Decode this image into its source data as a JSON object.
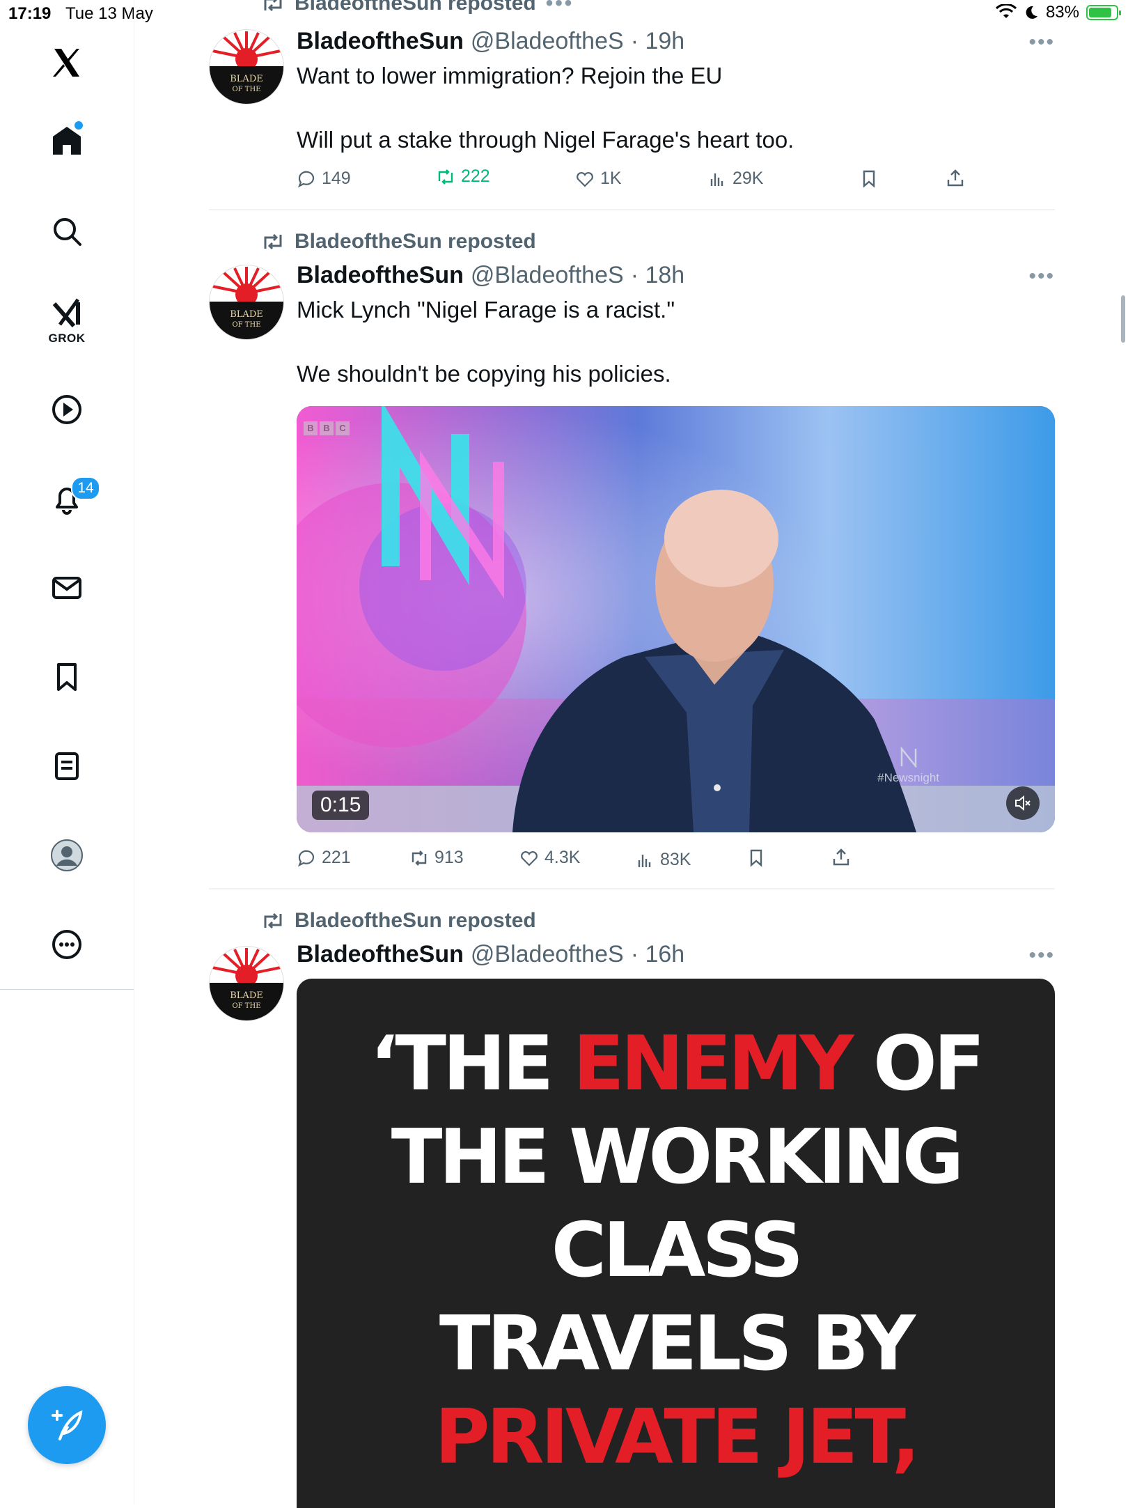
{
  "status_bar": {
    "time": "17:19",
    "date": "Tue 13 May",
    "battery": "83%",
    "battery_level": 0.83
  },
  "sidebar": {
    "grok_label": "GROK",
    "notifications_count": "14",
    "items": [
      "home-icon",
      "search-icon",
      "grok-icon",
      "video-icon",
      "bell-icon",
      "mail-icon",
      "bookmark-icon",
      "list-icon",
      "profile-icon",
      "more-icon"
    ]
  },
  "top_partial": {
    "repost_label": "BladeoftheSun reposted"
  },
  "tweets": [
    {
      "repost_label": "BladeoftheSun reposted",
      "name": "BladeoftheSun",
      "handle": "@BladeoftheS",
      "time": "· 19h",
      "text": "Want to lower immigration? Rejoin the EU\n\nWill put a stake through Nigel Farage's heart too.",
      "replies": "149",
      "reposts": "222",
      "likes": "1K",
      "views": "29K"
    },
    {
      "repost_label": "BladeoftheSun reposted",
      "name": "BladeoftheSun",
      "handle": "@BladeoftheS",
      "time": "· 18h",
      "text": "Mick Lynch \"Nigel Farage is a racist.\"\n\nWe shouldn't be copying his policies.",
      "video": {
        "duration": "0:15",
        "watermark": "#Newsnight",
        "bbc": [
          "B",
          "B",
          "C"
        ]
      },
      "replies": "221",
      "reposts": "913",
      "likes": "4.3K",
      "views": "83K"
    },
    {
      "repost_label": "BladeoftheSun reposted",
      "name": "BladeoftheSun",
      "handle": "@BladeoftheS",
      "time": "· 16h",
      "poster": {
        "line1_a": "‘THE ",
        "line1_b": "ENEMY",
        "line1_c": " OF",
        "line2": "THE WORKING",
        "line3": "CLASS",
        "line4": "TRAVELS BY",
        "line5": "PRIVATE JET,"
      }
    }
  ],
  "more_label": "•••",
  "colors": {
    "accent": "#1d9bf0",
    "repost_green": "#00ba7c",
    "muted": "#536471",
    "poster_red": "#e41e26"
  }
}
